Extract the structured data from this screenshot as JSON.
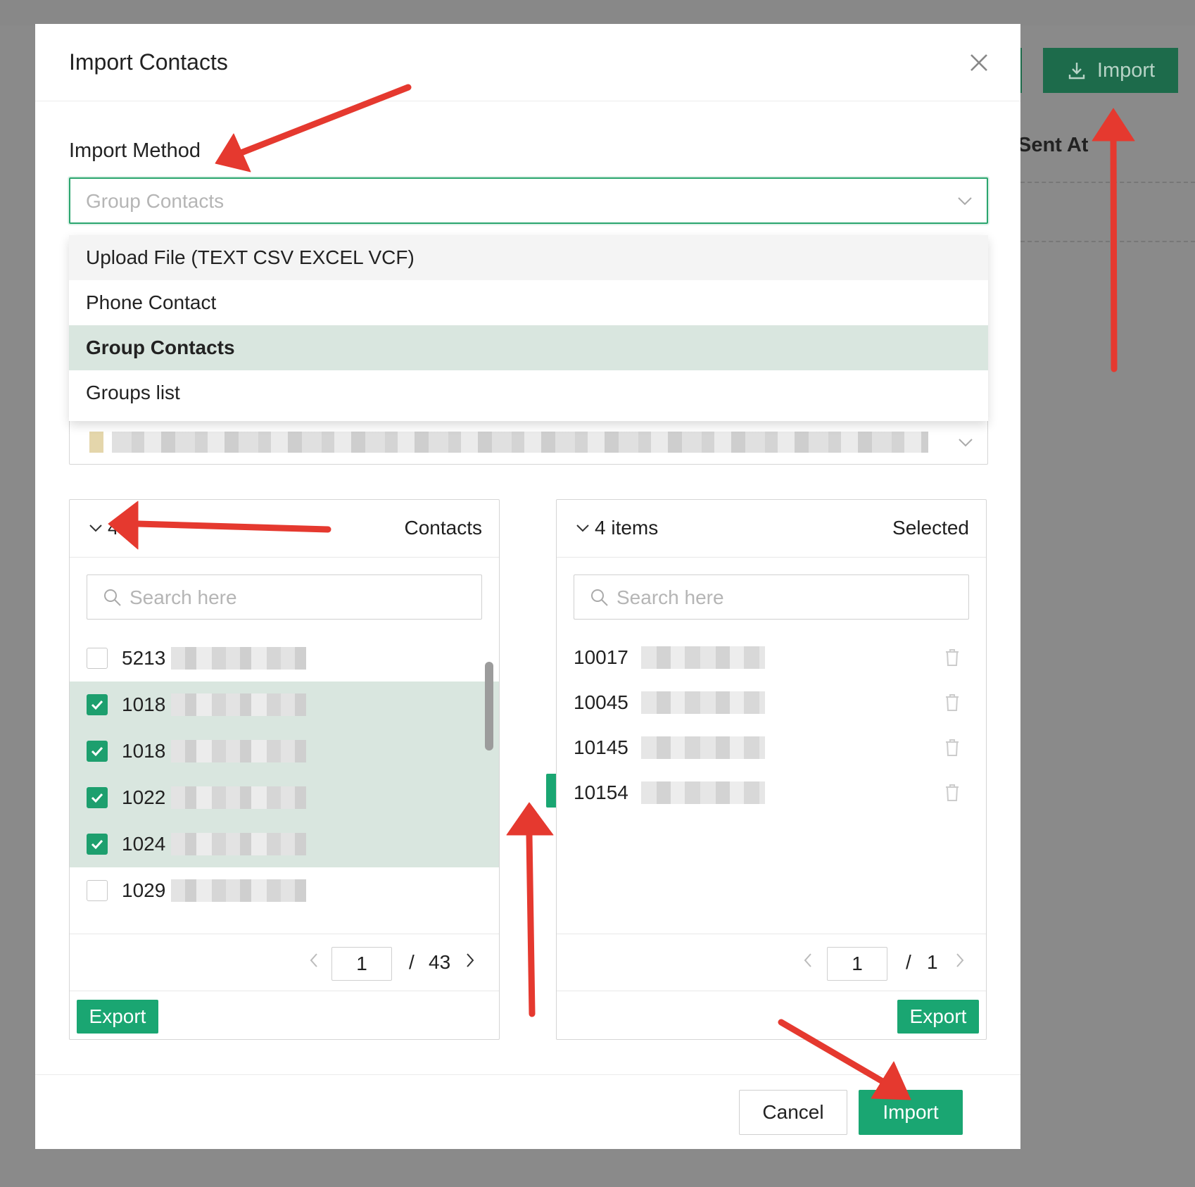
{
  "background": {
    "import_button": "Import",
    "sent_at_header": "Sent At"
  },
  "modal": {
    "title": "Import Contacts",
    "import_method_label": "Import Method",
    "select_placeholder": "Group Contacts",
    "dropdown_options": [
      "Upload File (TEXT CSV EXCEL VCF)",
      "Phone Contact",
      "Group Contacts",
      "Groups list"
    ],
    "selected_option": "Group Contacts",
    "left_panel": {
      "count_label": "4",
      "title": "Contacts",
      "search_placeholder": "Search here",
      "rows": [
        {
          "id": "5213",
          "checked": false
        },
        {
          "id": "1018",
          "checked": true
        },
        {
          "id": "1018",
          "checked": true
        },
        {
          "id": "1022",
          "checked": true
        },
        {
          "id": "1024",
          "checked": true
        },
        {
          "id": "1029",
          "checked": false
        }
      ],
      "page_current": "1",
      "page_separator": "/",
      "page_total": "43",
      "export_label": "Export"
    },
    "right_panel": {
      "count_label": "4 items",
      "title": "Selected",
      "search_placeholder": "Search here",
      "rows": [
        "10017",
        "10045",
        "10145",
        "10154"
      ],
      "page_current": "1",
      "page_separator": "/",
      "page_total": "1",
      "export_label": "Export"
    },
    "cancel_label": "Cancel",
    "import_label": "Import"
  },
  "colors": {
    "accent": "#1aa672",
    "selected_row": "#d9e6df",
    "annotation_arrow": "#e5392f"
  }
}
